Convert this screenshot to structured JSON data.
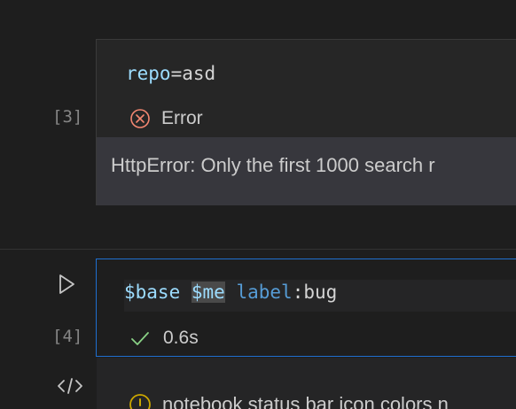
{
  "cell3": {
    "execution_count": "[3]",
    "code": {
      "keyword": "repo",
      "operator": "=",
      "value": "asd"
    },
    "status": {
      "icon": "error-circle-icon",
      "label": "Error"
    },
    "output": "HttpError: Only the first 1000 search r"
  },
  "cell4": {
    "execution_count": "[4]",
    "code": {
      "var1": "$base",
      "var2": "$me",
      "qualifier": "label",
      "sep": ":",
      "value": "bug"
    },
    "status": {
      "icon": "check-icon",
      "label": "0.6s"
    },
    "output": {
      "icon": "warning-icon",
      "text": "notebook status bar icon colors n"
    }
  },
  "colors": {
    "background": "#1e1e1e",
    "cell_focus_border": "#1f6fd0",
    "error": "#f48771",
    "success": "#89d185",
    "warning": "#cca700",
    "keyword": "#9cdcfe"
  }
}
